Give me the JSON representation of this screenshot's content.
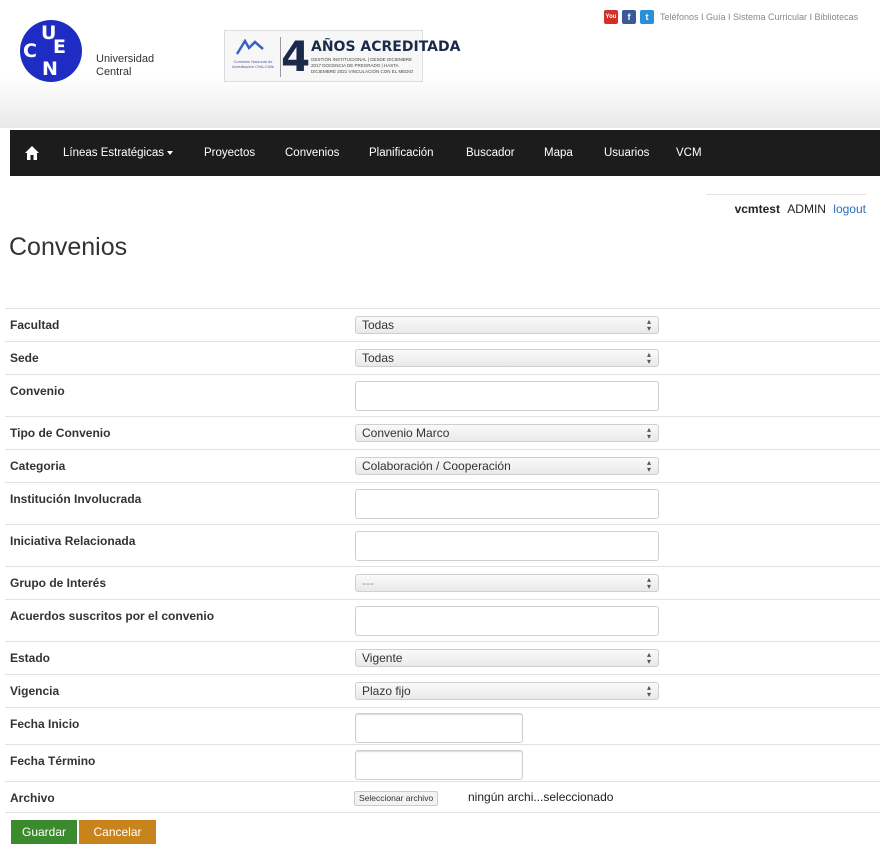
{
  "header": {
    "logo_letters": [
      "U",
      "C",
      "E",
      "N"
    ],
    "university_name": "Universidad\nCentral",
    "accreditation": {
      "big_number": "4",
      "headline": "AÑOS ACREDITADA",
      "agency": "Comisión Nacional de Acreditación CNA-Chile",
      "detail": "GESTIÓN INSTITUCIONAL | DESDE DICIEMBRE 2017 DOCENCIA DE PREGRADO | HASTA DICIEMBRE 2021 VINCULACIÓN CON EL MEDIO"
    },
    "social": [
      {
        "name": "youtube-icon",
        "label": "You",
        "color": "#d4302a"
      },
      {
        "name": "facebook-icon",
        "label": "f",
        "color": "#3b5998"
      },
      {
        "name": "twitter-icon",
        "label": "t",
        "color": "#2a8fd8"
      }
    ],
    "top_links": "Teléfonos I Guía I Sistema Curricular I Bibliotecas"
  },
  "nav": {
    "items": [
      {
        "label": "Líneas Estratégicas",
        "dropdown": true
      },
      {
        "label": "Proyectos"
      },
      {
        "label": "Convenios"
      },
      {
        "label": "Planificación"
      },
      {
        "label": "Buscador"
      },
      {
        "label": "Mapa"
      },
      {
        "label": "Usuarios"
      },
      {
        "label": "VCM"
      }
    ]
  },
  "user": {
    "username": "vcmtest",
    "role": "ADMIN",
    "logout": "logout"
  },
  "page": {
    "title": "Convenios"
  },
  "form": {
    "facultad": {
      "label": "Facultad",
      "value": "Todas"
    },
    "sede": {
      "label": "Sede",
      "value": "Todas"
    },
    "convenio": {
      "label": "Convenio",
      "value": ""
    },
    "tipo": {
      "label": "Tipo de Convenio",
      "value": "Convenio Marco"
    },
    "categoria": {
      "label": "Categoria",
      "value": "Colaboración / Cooperación"
    },
    "institucion": {
      "label": "Institución Involucrada",
      "value": ""
    },
    "iniciativa": {
      "label": "Iniciativa Relacionada",
      "value": ""
    },
    "grupo": {
      "label": "Grupo de Interés",
      "value": "---"
    },
    "acuerdos": {
      "label": "Acuerdos suscritos por el convenio",
      "value": ""
    },
    "estado": {
      "label": "Estado",
      "value": "Vigente"
    },
    "vigencia": {
      "label": "Vigencia",
      "value": "Plazo fijo"
    },
    "fecha_inicio": {
      "label": "Fecha Inicio",
      "value": ""
    },
    "fecha_termino": {
      "label": "Fecha Término",
      "value": ""
    },
    "archivo": {
      "label": "Archivo",
      "button": "Seleccionar archivo",
      "status": "ningún archi...seleccionado"
    }
  },
  "buttons": {
    "save": {
      "label": "Guardar",
      "color": "#3c8a2e"
    },
    "cancel": {
      "label": "Cancelar",
      "color": "#c8841a"
    }
  }
}
